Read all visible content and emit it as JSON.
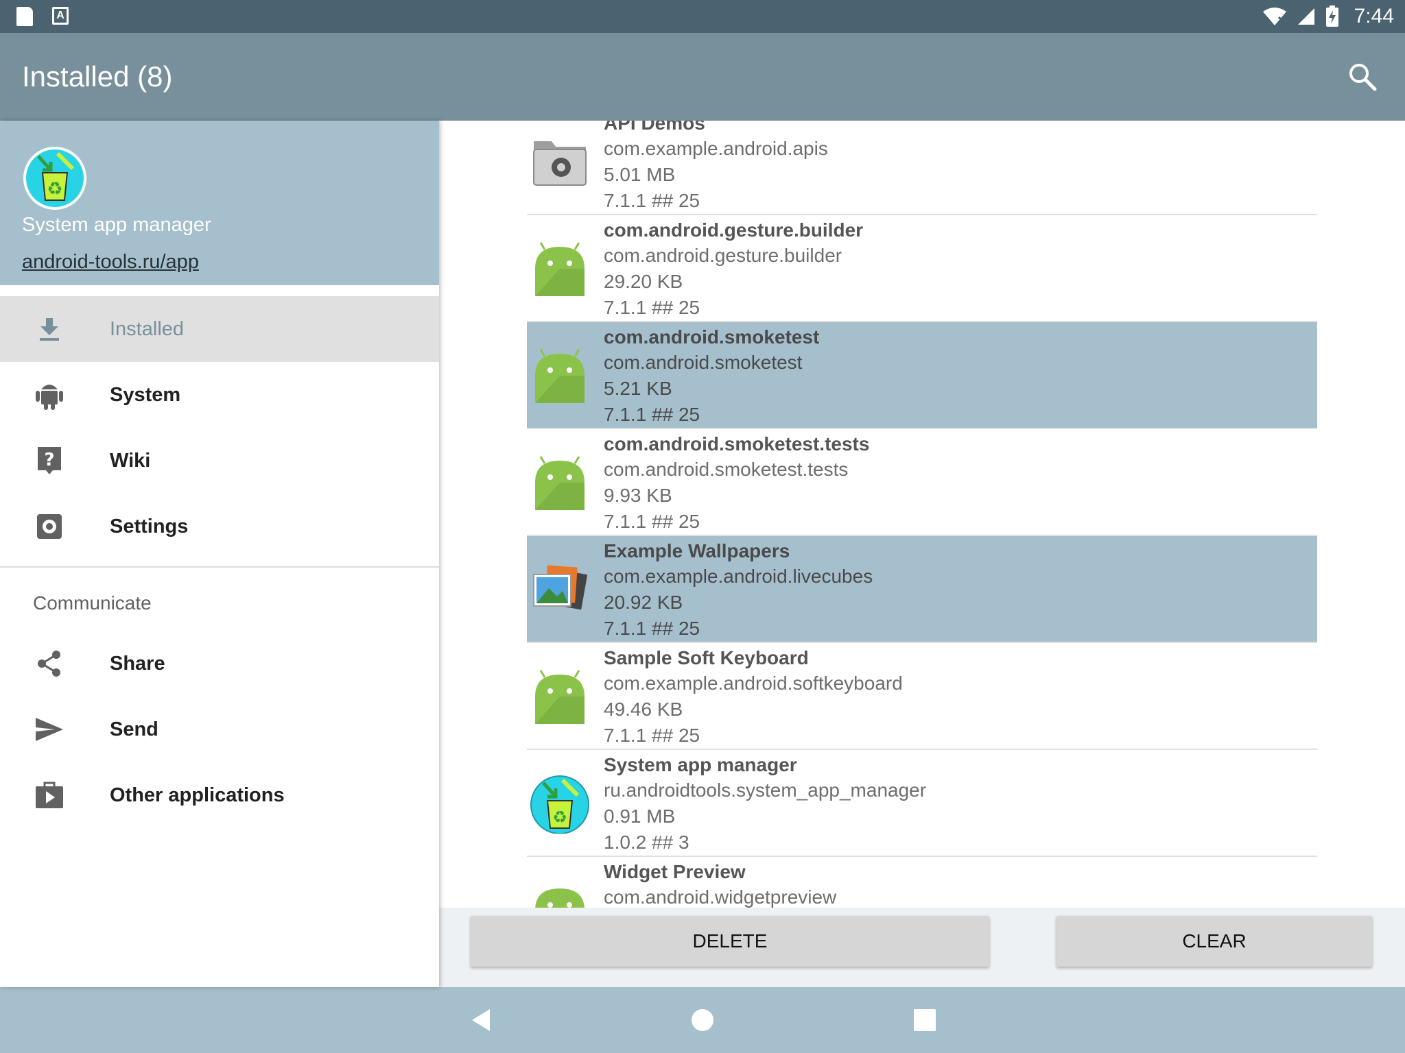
{
  "status_bar": {
    "time": "7:44"
  },
  "app_bar": {
    "title": "Installed (8)"
  },
  "drawer": {
    "app_name": "System app manager",
    "link": "android-tools.ru/app",
    "items": [
      {
        "label": "Installed",
        "icon": "download-icon",
        "active": true
      },
      {
        "label": "System",
        "icon": "android-icon"
      },
      {
        "label": "Wiki",
        "icon": "help-icon"
      },
      {
        "label": "Settings",
        "icon": "gear-icon"
      }
    ],
    "section_title": "Communicate",
    "communicate": [
      {
        "label": "Share",
        "icon": "share-icon"
      },
      {
        "label": "Send",
        "icon": "send-icon"
      },
      {
        "label": "Other applications",
        "icon": "play-store-icon"
      }
    ]
  },
  "apps": [
    {
      "name": "API Demos",
      "package": "com.example.android.apis",
      "size": "5.01 MB",
      "version": "7.1.1 ## 25",
      "icon": "folder-gear-icon",
      "selected": false
    },
    {
      "name": "com.android.gesture.builder",
      "package": "com.android.gesture.builder",
      "size": "29.20 KB",
      "version": "7.1.1 ## 25",
      "icon": "android-robot-icon",
      "selected": false
    },
    {
      "name": "com.android.smoketest",
      "package": "com.android.smoketest",
      "size": "5.21 KB",
      "version": "7.1.1 ## 25",
      "icon": "android-robot-icon",
      "selected": true
    },
    {
      "name": "com.android.smoketest.tests",
      "package": "com.android.smoketest.tests",
      "size": "9.93 KB",
      "version": "7.1.1 ## 25",
      "icon": "android-robot-icon",
      "selected": false
    },
    {
      "name": "Example Wallpapers",
      "package": "com.example.android.livecubes",
      "size": "20.92 KB",
      "version": "7.1.1 ## 25",
      "icon": "wallpaper-icon",
      "selected": true
    },
    {
      "name": "Sample Soft Keyboard",
      "package": "com.example.android.softkeyboard",
      "size": "49.46 KB",
      "version": "7.1.1 ## 25",
      "icon": "android-robot-icon",
      "selected": false
    },
    {
      "name": "System app manager",
      "package": "ru.androidtools.system_app_manager",
      "size": "0.91 MB",
      "version": "1.0.2 ## 3",
      "icon": "recycle-bin-icon",
      "selected": false
    },
    {
      "name": "Widget Preview",
      "package": "com.android.widgetpreview",
      "size": "",
      "version": "",
      "icon": "android-robot-icon",
      "selected": false
    }
  ],
  "actions": {
    "delete": "DELETE",
    "clear": "CLEAR"
  },
  "colors": {
    "status_bar": "#4b6270",
    "app_bar": "#78909c",
    "accent_light": "#a6bfcc",
    "android_green": "#8bc34a"
  }
}
